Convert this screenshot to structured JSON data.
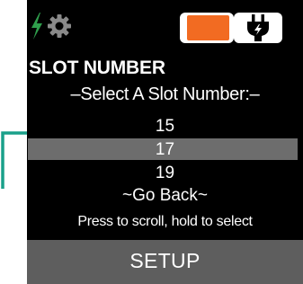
{
  "colors": {
    "screen_bg": "#000000",
    "bolt": "#2f9e4c",
    "gear": "#8a8a8a",
    "battery_fill": "#f26b22",
    "highlight": "#6d6d6d",
    "setup_bar": "#5e5e5e",
    "pointer_arrow": "#1aa08a"
  },
  "header": {
    "icons": [
      "bolt-icon",
      "gear-icon",
      "battery-icon",
      "plug-icon"
    ]
  },
  "menu": {
    "title": "SLOT NUMBER",
    "subtitle": "–Select A Slot Number:–",
    "options": [
      "15",
      "17",
      "19"
    ],
    "selected_index": 1,
    "back_label": "~Go Back~"
  },
  "hint": "Press to scroll, hold to select",
  "footer": {
    "label": "SETUP"
  }
}
